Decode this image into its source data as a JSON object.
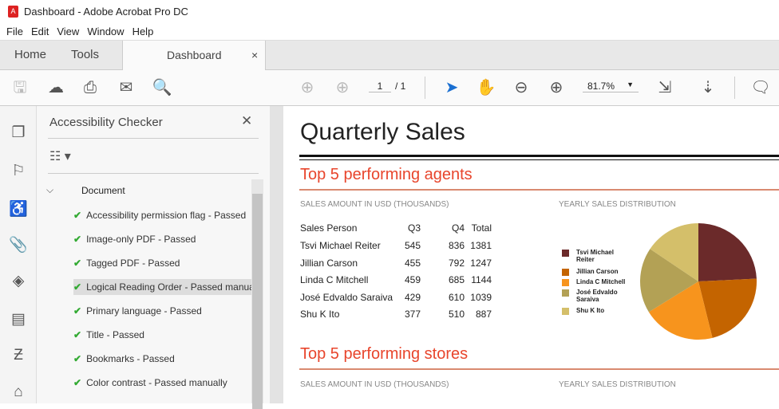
{
  "window": {
    "title": "Dashboard - Adobe Acrobat Pro DC"
  },
  "menu": [
    "File",
    "Edit",
    "View",
    "Window",
    "Help"
  ],
  "tabs": {
    "home": "Home",
    "tools": "Tools",
    "doc": "Dashboard",
    "close": "×"
  },
  "toolbar": {
    "page_current": "1",
    "page_total": "/ 1",
    "zoom": "81.7%"
  },
  "panel": {
    "title": "Accessibility Checker",
    "close": "✕",
    "section": "Document",
    "items": [
      "Accessibility permission flag - Passed",
      "Image-only PDF - Passed",
      "Tagged PDF - Passed",
      "Logical Reading Order - Passed manua",
      "Primary language - Passed",
      "Title - Passed",
      "Bookmarks - Passed",
      "Color contrast - Passed manually"
    ]
  },
  "doc": {
    "title": "Quarterly Sales",
    "agents_heading": "Top 5 performing agents",
    "stores_heading": "Top 5 performing stores",
    "table_caption": "SALES AMOUNT IN USD (THOUSANDS)",
    "chart_caption": "YEARLY SALES DISTRIBUTION",
    "table_caption2": "SALES AMOUNT IN USD (THOUSANDS)",
    "chart_caption2": "YEARLY SALES DISTRIBUTION",
    "headers": [
      "Sales Person",
      "Q3",
      "Q4",
      "Total"
    ],
    "rows": [
      [
        "Tsvi Michael Reiter",
        "545",
        "836",
        "1381"
      ],
      [
        "Jillian  Carson",
        "455",
        "792",
        "1247"
      ],
      [
        "Linda C Mitchell",
        "459",
        "685",
        "1144"
      ],
      [
        "José Edvaldo Saraiva",
        "429",
        "610",
        "1039"
      ],
      [
        "Shu K Ito",
        "377",
        "510",
        "887"
      ]
    ]
  },
  "chart_data": {
    "type": "pie",
    "title": "YEARLY SALES DISTRIBUTION",
    "labels": [
      "Tsvi Michael Reiter",
      "Jillian  Carson",
      "Linda C Mitchell",
      "José Edvaldo Saraiva",
      "Shu K Ito"
    ],
    "values": [
      1381,
      1247,
      1144,
      1039,
      887
    ],
    "colors": [
      "#6b2a2a",
      "#c46400",
      "#f7941d",
      "#b3a155",
      "#d4bf6a"
    ]
  }
}
